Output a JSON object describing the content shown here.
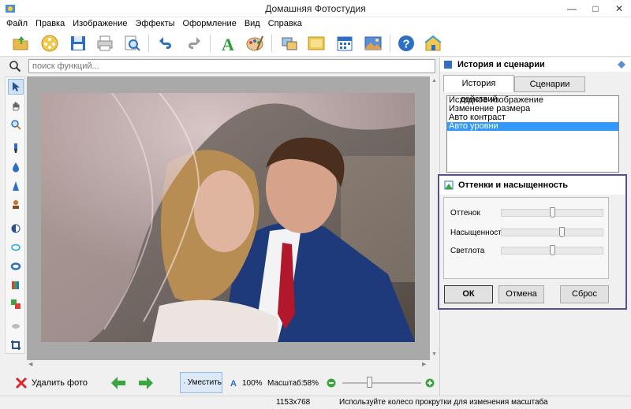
{
  "window": {
    "title": "Домашняя Фотостудия"
  },
  "menu": [
    "Файл",
    "Правка",
    "Изображение",
    "Эффекты",
    "Оформление",
    "Вид",
    "Справка"
  ],
  "toolbar_icons": [
    "open-folder-icon",
    "film-reel-icon",
    "save-icon",
    "print-icon",
    "print-preview-icon",
    "undo-icon",
    "redo-icon",
    "text-icon",
    "palette-icon",
    "collage-icon",
    "frame-icon",
    "calendar-icon",
    "postcard-icon",
    "help-icon",
    "home-icon"
  ],
  "search": {
    "placeholder": "поиск функций..."
  },
  "left_tools": [
    "pointer-icon",
    "hand-icon",
    "zoom-icon",
    "brush-icon",
    "drop-icon",
    "sharpen-icon",
    "stamp-icon",
    "contrast-icon",
    "ellipse-icon",
    "ring-icon",
    "levels-icon",
    "color-icon",
    "eraser-icon",
    "crop-icon"
  ],
  "bottom": {
    "delete_label": "Удалить фото",
    "fit_label": "Уместить",
    "zoom100_label": "100%",
    "scale_label": "Масштаб:",
    "scale_value": "58%",
    "zoom_level": 0.31
  },
  "status": {
    "dimensions": "1153x768",
    "hint": "Используйте колесо прокрутки для изменения масштаба"
  },
  "right_panel": {
    "header": "История и сценарии",
    "tabs": [
      "История действий",
      "Сценарии"
    ],
    "history": [
      "Исходное изображение",
      "Изменение размера",
      "Авто контраст",
      "Авто уровни"
    ],
    "selected_index": 3
  },
  "hsl": {
    "title": "Оттенки и насыщенность",
    "sliders": [
      {
        "label": "Оттенок",
        "level": 0.5
      },
      {
        "label": "Насыщенность",
        "level": 0.6
      },
      {
        "label": "Светлота",
        "level": 0.5
      }
    ],
    "ok": "ОК",
    "cancel": "Отмена",
    "reset": "Сброс"
  },
  "colors": {
    "accent": "#3399ff",
    "panel_border": "#5a4f96"
  }
}
